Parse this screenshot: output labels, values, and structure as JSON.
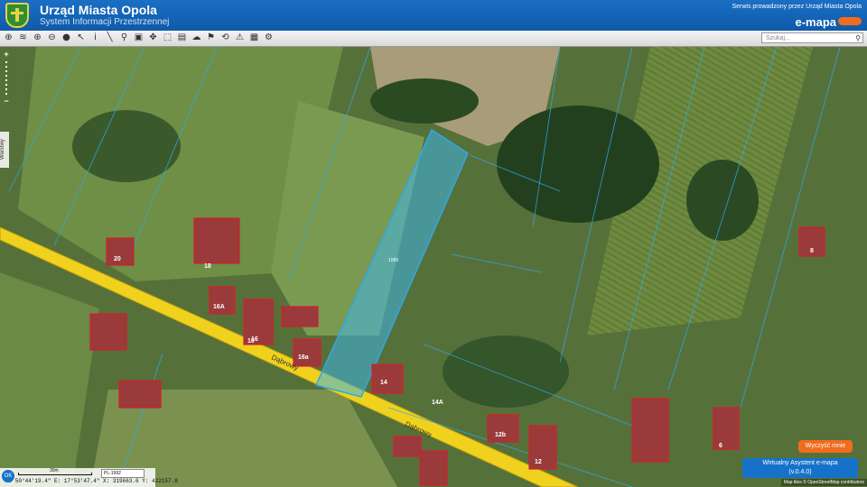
{
  "header": {
    "title": "Urząd Miasta Opola",
    "subtitle": "System Informacji Przestrzennej",
    "served_by": "Serwis prowadzony przez Urząd Miasta Opola",
    "brand": "e-mapa"
  },
  "toolbar": {
    "search_placeholder": "Szukaj...",
    "icons": [
      "globe-icon",
      "layers-icon",
      "zoom-in-icon",
      "zoom-out-icon",
      "full-extent-icon",
      "pointer-icon",
      "info-icon",
      "measure-line-icon",
      "measure-area-icon",
      "print-icon",
      "pan-icon",
      "select-icon",
      "table-icon",
      "cloud-icon",
      "pin-icon",
      "route-icon",
      "warning-icon",
      "palette-icon",
      "tools-icon"
    ]
  },
  "map": {
    "street_name": "Dąbrowy",
    "building_numbers": [
      "20",
      "18",
      "16A",
      "16",
      "10",
      "16a",
      "14",
      "14A",
      "12b",
      "12",
      "8",
      "6"
    ],
    "parcel_label": "1089",
    "colors": {
      "road": "#f0d21e",
      "parcel_outline": "#2fa8e6",
      "highlight_fill": "#3fb6e6",
      "building_outline": "#d0202e"
    }
  },
  "zoom": {
    "plus": "+",
    "minus": "−"
  },
  "side_tab": "Warstwy",
  "buttons": {
    "close_all": "Wyczyść mnie",
    "assistant_line1": "Wirtualny Asystent e-mapa",
    "assistant_line2": "(v.0.4.0)"
  },
  "scale": {
    "label": "30m",
    "crs": "PL-1992",
    "coords": "N: 50°44'19.4\"  E: 17°53'47.4\"  X: 319663.6  Y: 422157.8"
  },
  "ok_label": "OK",
  "attribution": "Map tiles © OpenStreetMap contributors"
}
